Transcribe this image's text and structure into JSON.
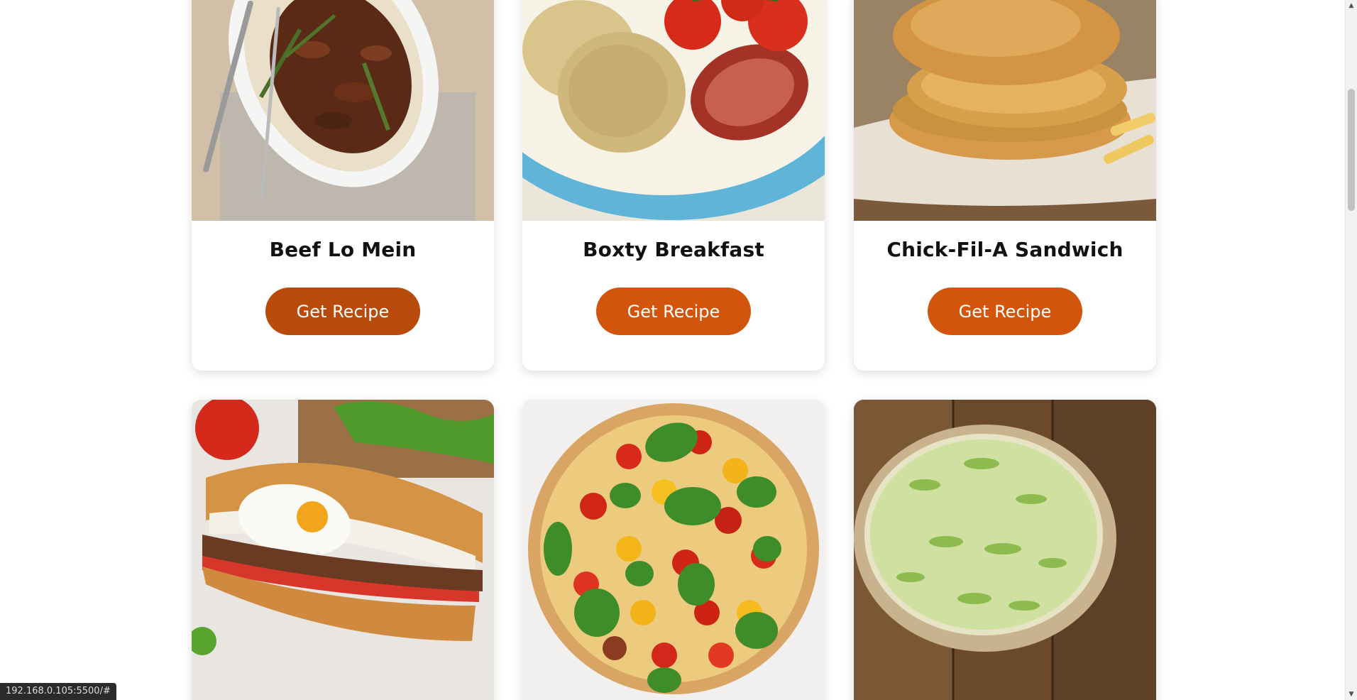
{
  "cards": [
    {
      "title": "Beef Lo Mein",
      "button_label": "Get Recipe",
      "image_icon": "beef-lo-mein-photo",
      "button_color": "#b84a0c"
    },
    {
      "title": "Boxty Breakfast",
      "button_label": "Get Recipe",
      "image_icon": "boxty-breakfast-photo",
      "button_color": "#d1550d"
    },
    {
      "title": "Chick-Fil-A Sandwich",
      "button_label": "Get Recipe",
      "image_icon": "chicken-sandwich-photo",
      "button_color": "#d1550d"
    },
    {
      "title": "",
      "button_label": "",
      "image_icon": "steak-egg-sandwich-photo"
    },
    {
      "title": "",
      "button_label": "",
      "image_icon": "tomato-tart-photo"
    },
    {
      "title": "",
      "button_label": "",
      "image_icon": "leek-quiche-photo"
    }
  ],
  "status_bar": {
    "url": "192.168.0.105:5500/#"
  },
  "colors": {
    "accent": "#d1550d",
    "accent_dark": "#b84a0c",
    "page_bg": "#ffffff"
  }
}
